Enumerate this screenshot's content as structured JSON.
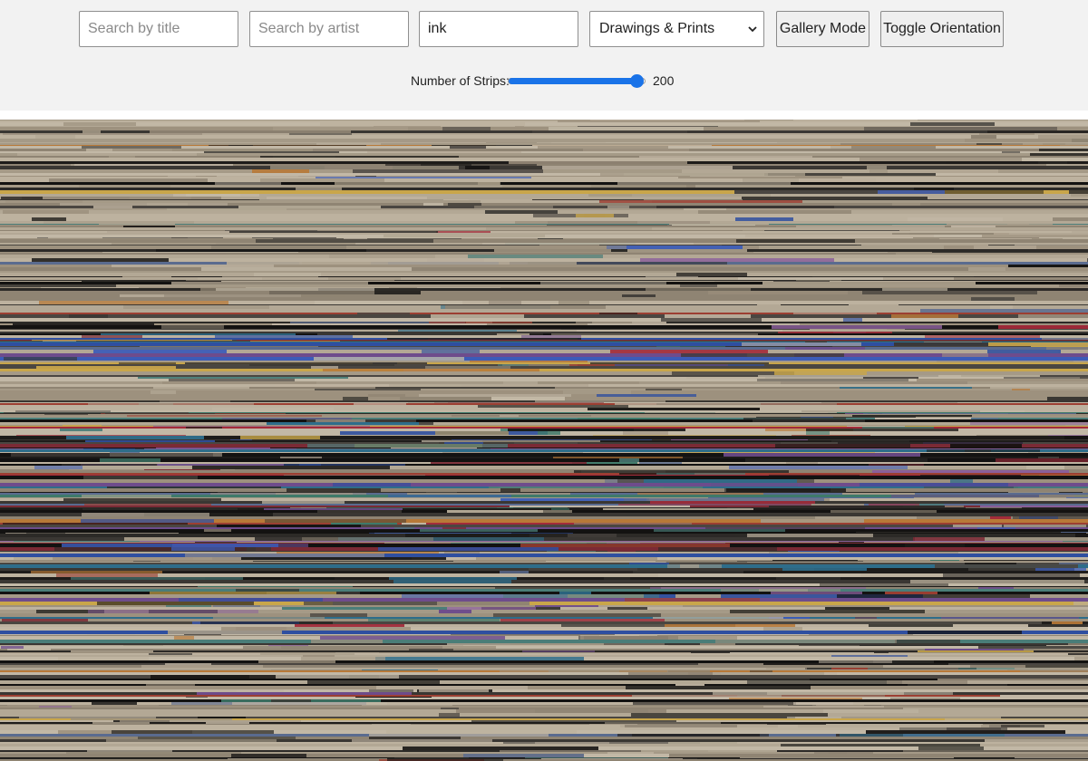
{
  "filters": {
    "title_placeholder": "Search by title",
    "title_value": "",
    "artist_placeholder": "Search by artist",
    "artist_value": "",
    "medium_value": "ink",
    "department_selected": "Drawings & Prints"
  },
  "buttons": {
    "gallery_mode": "Gallery Mode",
    "toggle_orientation": "Toggle Orientation"
  },
  "strips_control": {
    "label": "Number of Strips:",
    "value": "200",
    "fraction": 0.93
  },
  "icons": {
    "select_arrow": "chevron-down-icon"
  },
  "colors": {
    "toolbar_bg": "#f2f2f2",
    "accent": "#1a73e8",
    "paper": "#a39785"
  }
}
